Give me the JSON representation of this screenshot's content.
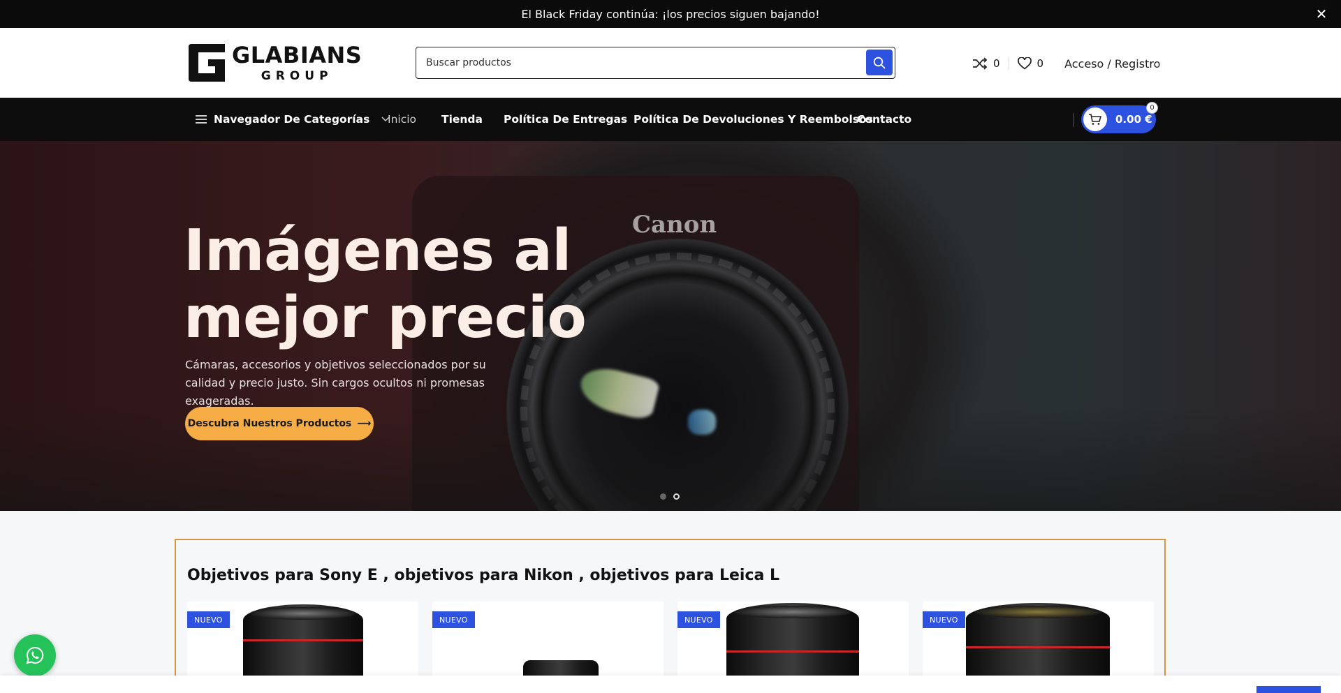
{
  "promo": {
    "text": "El Black Friday continúa: ¡los precios siguen bajando!",
    "close_icon": "close-icon"
  },
  "header": {
    "logo": {
      "word1": "GLABIANS",
      "word2": "GROUP"
    },
    "search": {
      "placeholder": "Buscar productos",
      "value": ""
    },
    "compare_count": "0",
    "wishlist_count": "0",
    "account_label": "Acceso / Registro"
  },
  "nav": {
    "categories_label": "Navegador De Categorías",
    "links": [
      "Inicio",
      "Tienda",
      "Política De Entregas",
      "Política De Devoluciones Y Reembolsos",
      "Contacto"
    ],
    "cart_amount": "0.00 €",
    "cart_count": "0"
  },
  "hero": {
    "title_line1": "Imágenes al",
    "title_line2": "mejor precio",
    "subtitle": "Cámaras, accesorios y objetivos seleccionados por su calidad y precio justo. Sin cargos ocultos ni promesas exageradas.",
    "cta_label": "Descubra Nuestros Productos",
    "cta_arrow": "⟶",
    "brand_text": "Canon",
    "slides": 2,
    "active_slide": 2
  },
  "products_section": {
    "title": "Objetivos para Sony E , objetivos para Nikon , objetivos para Leica L",
    "cards": [
      {
        "tag": "NUEVO"
      },
      {
        "tag": "NUEVO"
      },
      {
        "tag": "NUEVO"
      },
      {
        "tag": "NUEVO"
      }
    ]
  },
  "colors": {
    "accent": "#2e52e0",
    "cta": "#f6ad45",
    "section_border": "#d9963d",
    "whatsapp": "#25c25a"
  }
}
